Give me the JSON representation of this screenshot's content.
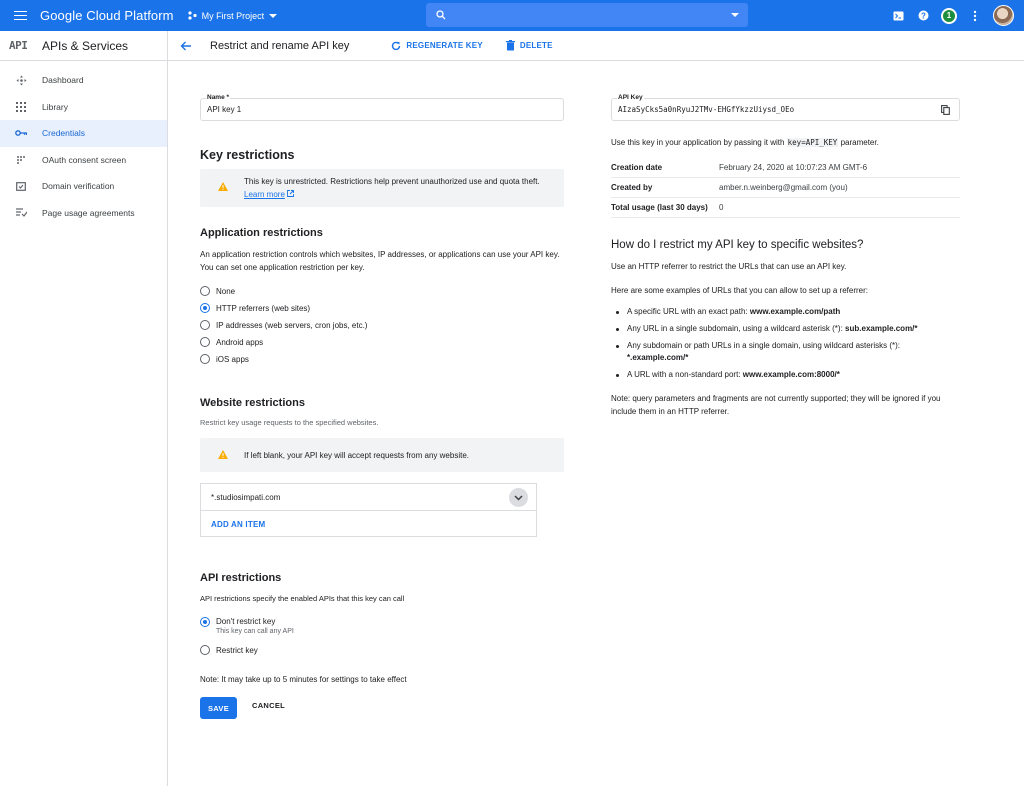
{
  "topbar": {
    "brand": "Google Cloud Platform",
    "project": "My First Project",
    "notification_count": "1"
  },
  "sidebar": {
    "logo": "API",
    "title": "APIs & Services",
    "items": [
      {
        "label": "Dashboard",
        "icon": "dashboard-icon"
      },
      {
        "label": "Library",
        "icon": "library-icon"
      },
      {
        "label": "Credentials",
        "icon": "key-icon",
        "active": true
      },
      {
        "label": "OAuth consent screen",
        "icon": "oauth-icon"
      },
      {
        "label": "Domain verification",
        "icon": "domain-icon"
      },
      {
        "label": "Page usage agreements",
        "icon": "agreements-icon"
      }
    ]
  },
  "actionbar": {
    "title": "Restrict and rename API key",
    "regenerate_label": "REGENERATE KEY",
    "delete_label": "DELETE"
  },
  "name_field": {
    "label": "Name *",
    "value": "API key 1"
  },
  "key_restrictions": {
    "heading": "Key restrictions",
    "warning": "This key is unrestricted. Restrictions help prevent unauthorized use and quota theft.",
    "learn_more": "Learn more"
  },
  "application_restrictions": {
    "heading": "Application restrictions",
    "description": "An application restriction controls which websites, IP addresses, or applications can use your API key. You can set one application restriction per key.",
    "options": [
      "None",
      "HTTP referrers (web sites)",
      "IP addresses (web servers, cron jobs, etc.)",
      "Android apps",
      "iOS apps"
    ],
    "selected": "HTTP referrers (web sites)"
  },
  "website_restrictions": {
    "heading": "Website restrictions",
    "description": "Restrict key usage requests to the specified websites.",
    "warning": "If left blank, your API key will accept requests from any website.",
    "referrer": "*.studiosimpati.com",
    "add_item": "ADD AN ITEM"
  },
  "api_restrictions": {
    "heading": "API restrictions",
    "description": "API restrictions specify the enabled APIs that this key can call",
    "option_dont": "Don't restrict key",
    "option_dont_sub": "This key can call any API",
    "option_restrict": "Restrict key",
    "note": "Note: It may take up to 5 minutes for settings to take effect"
  },
  "buttons": {
    "save": "SAVE",
    "cancel": "CANCEL"
  },
  "api_key": {
    "label": "API Key",
    "value": "AIzaSyCks5a0nRyuJ2TMv-EHGfYkzzUiysd_OEo",
    "usage_prefix": "Use this key in your application by passing it with",
    "usage_code": "key=API_KEY",
    "usage_suffix": "parameter."
  },
  "meta": {
    "creation_date_label": "Creation date",
    "creation_date": "February 24, 2020 at 10:07:23 AM GMT-6",
    "created_by_label": "Created by",
    "created_by": "amber.n.weinberg@gmail.com (you)",
    "usage_label": "Total usage (last 30 days)",
    "usage": "0"
  },
  "help": {
    "heading": "How do I restrict my API key to specific websites?",
    "intro": "Use an HTTP referrer to restrict the URLs that can use an API key.",
    "examples_intro": "Here are some examples of URLs that you can allow to set up a referrer:",
    "b1_text": "A specific URL with an exact path:",
    "b1_bold": "www.example.com/path",
    "b2_text": "Any URL in a single subdomain, using a wildcard asterisk (*):",
    "b2_bold": "sub.example.com/*",
    "b3_text": "Any subdomain or path URLs in a single domain, using wildcard asterisks (*):",
    "b3_bold": "*.example.com/*",
    "b4_text": "A URL with a non-standard port:",
    "b4_bold": "www.example.com:8000/*",
    "note": "Note: query parameters and fragments are not currently supported; they will be ignored if you include them in an HTTP referrer."
  },
  "colors": {
    "primary": "#1a73e8",
    "warning": "#f9ab00",
    "active_bg": "#e8f0fe"
  }
}
